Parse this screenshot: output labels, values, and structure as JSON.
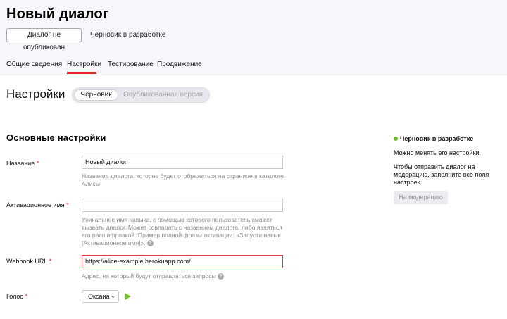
{
  "header": {
    "title": "Новый диалог",
    "status_button": "Диалог не опубликован",
    "draft_status": "Черновик в разработке",
    "tabs": [
      {
        "label": "Общие сведения"
      },
      {
        "label": "Настройки",
        "active": true
      },
      {
        "label": "Тестирование"
      },
      {
        "label": "Продвижение"
      }
    ]
  },
  "settings": {
    "heading": "Настройки",
    "version_toggle": {
      "active": "Черновик",
      "inactive": "Опубликованная версия"
    },
    "subheading": "Основные настройки",
    "fields": {
      "name": {
        "label": "Название",
        "required_mark": "*",
        "value": "Новый диалог",
        "hint": "Название диалога, которое будет отображаться на странице в каталоге Алисы"
      },
      "activation": {
        "label": "Активационное имя",
        "required_mark": "*",
        "value": "",
        "hint": "Уникальное имя навыка, с помощью которого пользователь сможет вызвать диалог. Может совпадать с названием диалога, либо являться его расшифровкой. Пример полной фразы активации: «Запусти навык [Активационное имя]».",
        "help_icon": "?"
      },
      "webhook": {
        "label": "Webhook URL",
        "required_mark": "*",
        "value": "https://alice-example.herokuapp.com/",
        "hint": "Адрес, на который будут отправляться запросы",
        "help_icon": "?"
      },
      "voice": {
        "label": "Голос",
        "required_mark": "*",
        "value": "Оксана"
      }
    }
  },
  "sidebar": {
    "status_title": "Черновик в разработке",
    "status_color": "#6fba2c",
    "text1": "Можно менять его настройки.",
    "text2": "Чтобы отправить диалог на модерацию, заполните все поля настроек.",
    "moderation_button": "На модерацию"
  },
  "colors": {
    "accent_red": "#e52620",
    "error_border": "#d93b3b",
    "play_green": "#6fba2c"
  }
}
